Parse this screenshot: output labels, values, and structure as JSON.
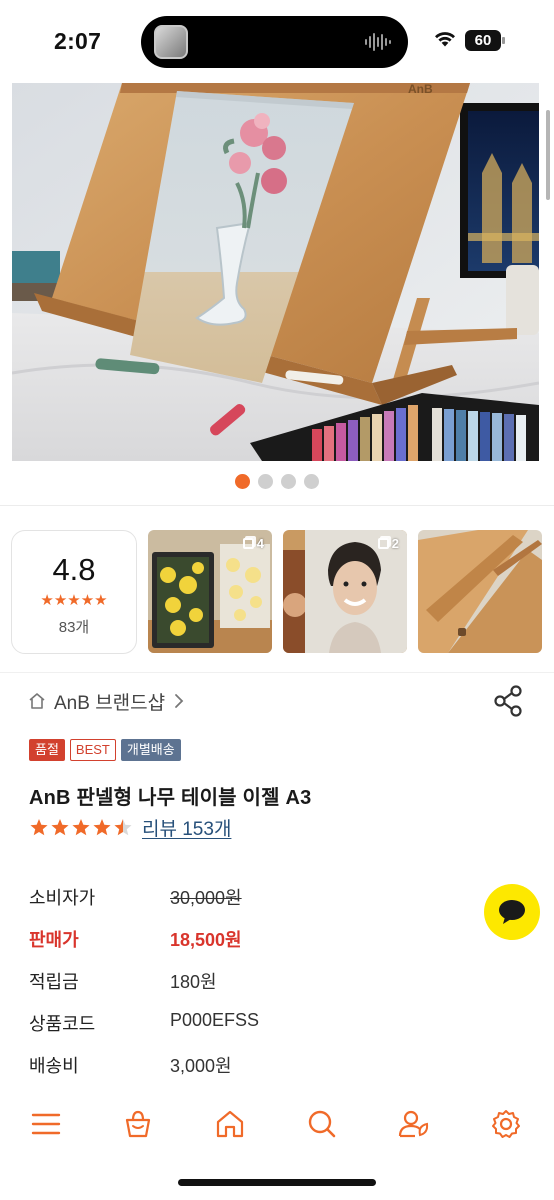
{
  "status_bar": {
    "time": "2:07",
    "battery": "60",
    "icons": [
      "audio-wave-icon",
      "wifi-icon",
      "battery-icon"
    ]
  },
  "gallery": {
    "image": "easel-photo",
    "brand_mark": "AnB",
    "page_count": 4,
    "current_page": 1
  },
  "reviews_summary": {
    "score": "4.8",
    "stars": "★★★★★",
    "count": "83개",
    "thumbnails": [
      {
        "image": "flower-painting-photo",
        "badge": "4"
      },
      {
        "image": "portrait-drawing-photo",
        "badge": "2"
      },
      {
        "image": "easel-closeup-photo",
        "badge": ""
      }
    ]
  },
  "product": {
    "brand": "AnB 브랜드샵",
    "badges": [
      "품절",
      "BEST",
      "개별배송"
    ],
    "title": "AnB 판넬형 나무 테이블 이젤 A3",
    "rating_stars": 4.5,
    "review_link": "리뷰 153개",
    "info": [
      {
        "label": "소비자가",
        "value": "30,000원"
      },
      {
        "label": "판매가",
        "value": "18,500원"
      },
      {
        "label": "적립금",
        "value": "180원"
      },
      {
        "label": "상품코드",
        "value": "P000EFSS"
      },
      {
        "label": "배송비",
        "value": "3,000원"
      }
    ]
  },
  "colors": {
    "accent": "#f06a29",
    "sale_red": "#d9352c",
    "link": "#27507a",
    "chat_yellow": "#fde800",
    "ship_badge": "#5d7391"
  },
  "bottom_nav": [
    "menu-icon",
    "shopping-bag-icon",
    "home-icon",
    "search-icon",
    "user-icon",
    "settings-icon"
  ]
}
